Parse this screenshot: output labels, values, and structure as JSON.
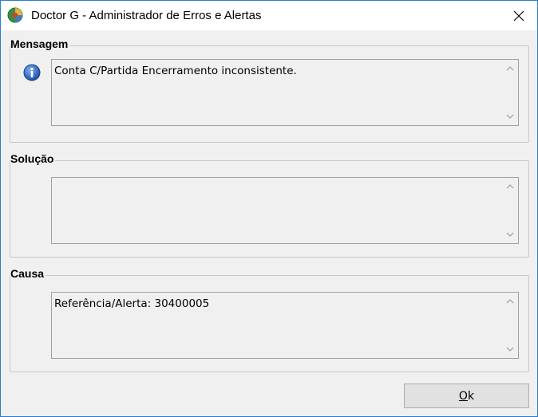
{
  "window": {
    "title": "Doctor G - Administrador de Erros e Alertas",
    "accent_color": "#2b7cd3"
  },
  "icons": {
    "app": "doctor-g-app-icon",
    "info": "info-icon",
    "close": "close-icon"
  },
  "mensagem": {
    "label": "Mensagem",
    "text": "Conta C/Partida Encerramento inconsistente."
  },
  "solucao": {
    "label": "Solução",
    "text": ""
  },
  "causa": {
    "label": "Causa",
    "text": "Referência/Alerta: 30400005"
  },
  "buttons": {
    "ok_mnemonic": "O",
    "ok_rest": "k"
  }
}
